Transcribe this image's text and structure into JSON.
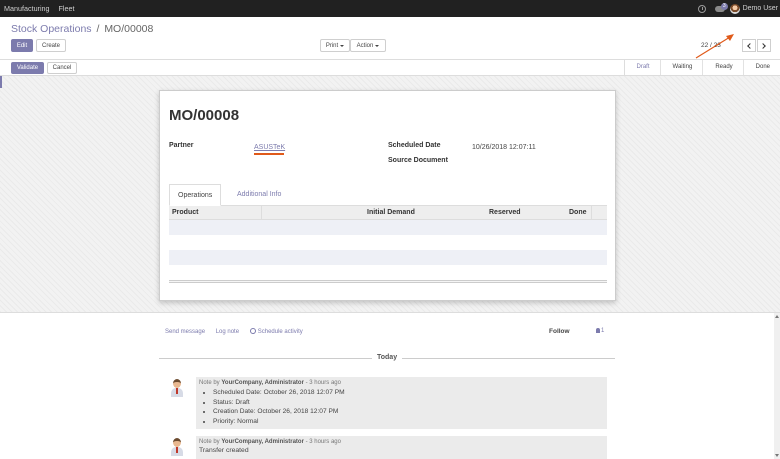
{
  "topbar": {
    "menu": [
      "Manufacturing",
      "Fleet"
    ],
    "chat_count": "3",
    "user_name": "Demo User"
  },
  "breadcrumb": {
    "parent": "Stock Operations",
    "separator": "/",
    "current": "MO/00008"
  },
  "buttons": {
    "edit": "Edit",
    "create": "Create",
    "print": "Print",
    "action": "Action",
    "validate": "Validate",
    "cancel": "Cancel"
  },
  "pager": {
    "value": "22 / 23"
  },
  "stages": [
    "Draft",
    "Waiting",
    "Ready",
    "Done"
  ],
  "sheet": {
    "title": "MO/00008",
    "partner_label": "Partner",
    "partner_value": "ASUSTeK",
    "scheduled_label": "Scheduled Date",
    "scheduled_value": "10/26/2018 12:07:11",
    "source_label": "Source Document",
    "source_value": ""
  },
  "tabs": [
    "Operations",
    "Additional Info"
  ],
  "table": {
    "headers": [
      "Product",
      "Initial Demand",
      "Reserved",
      "Done"
    ]
  },
  "chatter": {
    "send_message": "Send message",
    "log_note": "Log note",
    "schedule_activity": "Schedule activity",
    "follow": "Follow",
    "followers": "1",
    "today": "Today",
    "messages": [
      {
        "prefix": "Note by",
        "author": "YourCompany, Administrator",
        "time": "- 3 hours ago",
        "items": [
          "Scheduled Date: October 26, 2018 12:07 PM",
          "Status: Draft",
          "Creation Date: October 26, 2018 12:07 PM",
          "Priority: Normal"
        ]
      },
      {
        "prefix": "Note by",
        "author": "YourCompany, Administrator",
        "time": "- 3 hours ago",
        "body": "Transfer created"
      }
    ]
  },
  "colors": {
    "accent": "#7c7bad",
    "topbar": "#212121",
    "annotation": "#e05a1a"
  }
}
